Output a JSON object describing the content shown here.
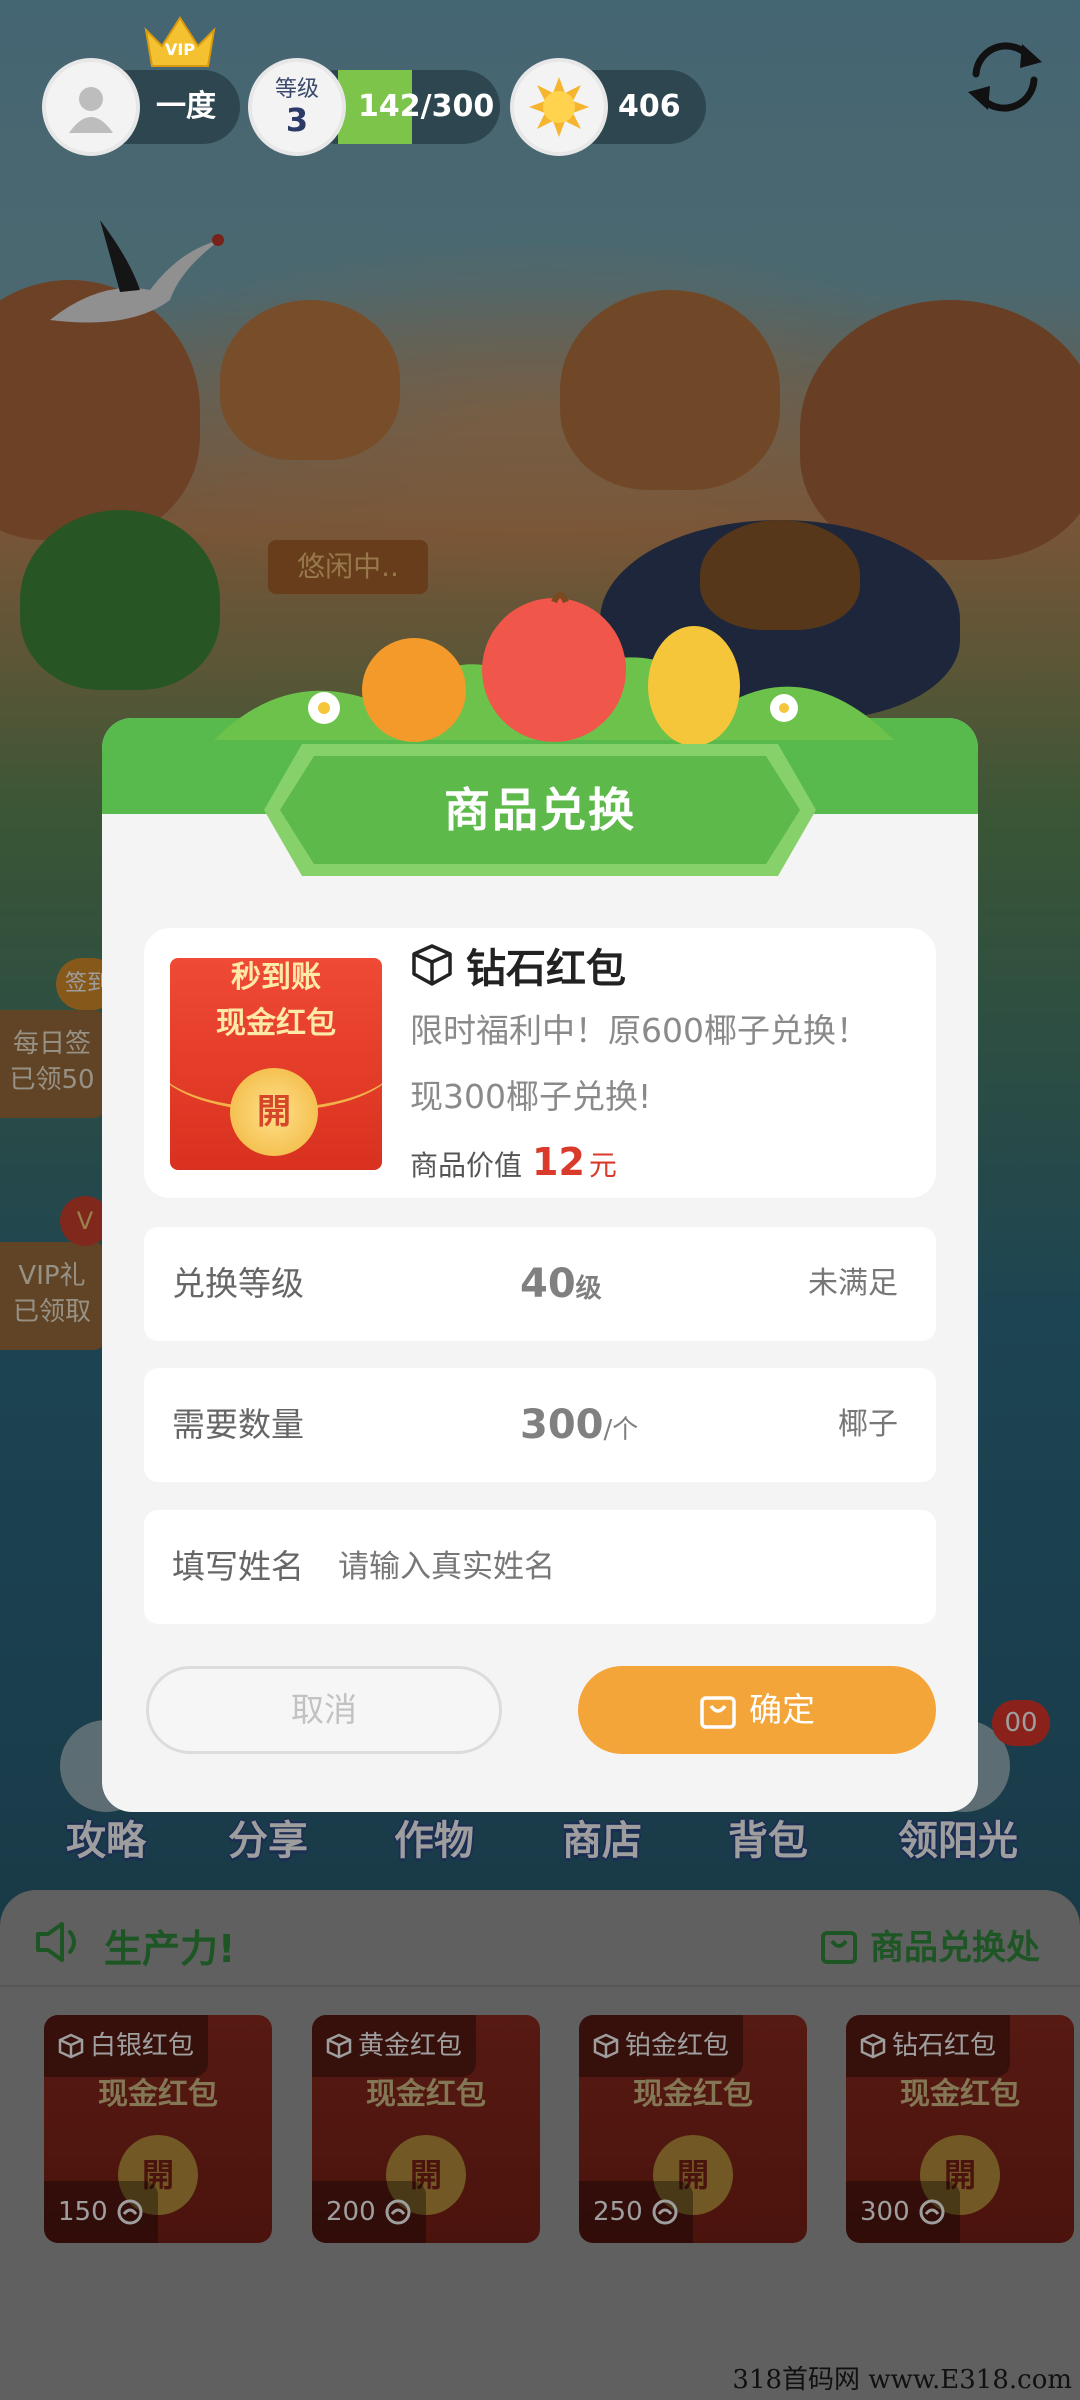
{
  "top_bar": {
    "vip_badge": "VIP",
    "username": "一度",
    "level_label": "等级",
    "level_value": "3",
    "exp": "142/300",
    "sun_count": "406"
  },
  "scene": {
    "sign_label": "悠闲中..",
    "side_buttons": [
      {
        "badge": "签到",
        "line1": "每日签",
        "line2": "已领50"
      },
      {
        "badge": "V",
        "line1": "VIP礼",
        "line2": "已领取"
      }
    ],
    "nav": [
      {
        "label": "攻略"
      },
      {
        "label": "分享"
      },
      {
        "label": "作物"
      },
      {
        "label": "商店"
      },
      {
        "label": "背包"
      },
      {
        "label": "领阳光"
      }
    ],
    "nav_badge": "00"
  },
  "modal": {
    "title": "商品兑换",
    "product": {
      "image_top": "秒到账",
      "image_text": "现金红包",
      "image_open": "開",
      "name": "钻石红包",
      "description": "限时福利中！原600椰子兑换！现300椰子兑换!",
      "value_label": "商品价值",
      "value_number": "12",
      "value_unit": "元"
    },
    "rows": [
      {
        "label": "兑换等级",
        "value": "40",
        "value_unit": "级",
        "status": "未满足"
      },
      {
        "label": "需要数量",
        "value": "300",
        "value_unit": "/个",
        "status": "椰子"
      }
    ],
    "name_field": {
      "label": "填写姓名",
      "placeholder": "请输入真实姓名"
    },
    "cancel_label": "取消",
    "confirm_label": "确定"
  },
  "shop": {
    "title": "生产力!",
    "link_label": "商品兑换处",
    "cards": [
      {
        "name": "白银红包",
        "price": "150"
      },
      {
        "name": "黄金红包",
        "price": "200"
      },
      {
        "name": "铂金红包",
        "price": "250"
      },
      {
        "name": "钻石红包",
        "price": "300"
      }
    ],
    "card_image_text": "现金红包",
    "card_open": "開"
  },
  "watermark": "318首码网 www.E318.com",
  "colors": {
    "primary_green": "#58b94d",
    "confirm_orange": "#f3a53a",
    "price_red": "#d93a2b",
    "shop_green": "#2f8b3b"
  }
}
